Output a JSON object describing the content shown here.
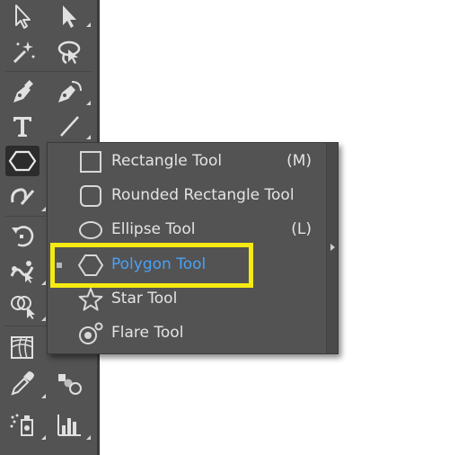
{
  "toolbar": {
    "tools": [
      {
        "name": "selection-tool",
        "icon": "arrow-outline-icon"
      },
      {
        "name": "direct-selection-tool",
        "icon": "arrow-solid-icon"
      },
      {
        "name": "magic-wand-tool",
        "icon": "magic-wand-icon"
      },
      {
        "name": "lasso-tool",
        "icon": "lasso-icon"
      },
      {
        "name": "pen-tool",
        "icon": "pen-icon"
      },
      {
        "name": "curvature-tool",
        "icon": "curvature-pen-icon"
      },
      {
        "name": "type-tool",
        "icon": "type-icon"
      },
      {
        "name": "line-segment-tool",
        "icon": "line-icon"
      },
      {
        "name": "polygon-tool",
        "icon": "hexagon-icon"
      },
      {
        "name": "shaper-tool",
        "icon": "shaper-icon"
      },
      {
        "name": "rotate-tool",
        "icon": "rotate-icon"
      },
      {
        "name": "puppet-warp-tool",
        "icon": "puppet-warp-icon"
      },
      {
        "name": "shape-builder-tool",
        "icon": "shape-builder-icon"
      },
      {
        "name": "mesh-tool",
        "icon": "mesh-icon"
      },
      {
        "name": "eyedropper-tool",
        "icon": "eyedropper-icon"
      },
      {
        "name": "blend-tool",
        "icon": "blend-icon"
      },
      {
        "name": "symbol-sprayer-tool",
        "icon": "symbol-sprayer-icon"
      },
      {
        "name": "column-graph-tool",
        "icon": "column-graph-icon"
      }
    ]
  },
  "flyout": {
    "items": [
      {
        "label": "Rectangle Tool",
        "shortcut": "(M)",
        "icon": "rectangle-icon"
      },
      {
        "label": "Rounded Rectangle Tool",
        "shortcut": "",
        "icon": "rounded-rectangle-icon"
      },
      {
        "label": "Ellipse Tool",
        "shortcut": "(L)",
        "icon": "ellipse-icon"
      },
      {
        "label": "Polygon Tool",
        "shortcut": "",
        "icon": "polygon-icon",
        "selected": true
      },
      {
        "label": "Star Tool",
        "shortcut": "",
        "icon": "star-icon"
      },
      {
        "label": "Flare Tool",
        "shortcut": "",
        "icon": "flare-icon"
      }
    ]
  },
  "colors": {
    "panel": "#535353",
    "selected_label": "#4aa1f3",
    "highlight": "#f5ea12"
  }
}
